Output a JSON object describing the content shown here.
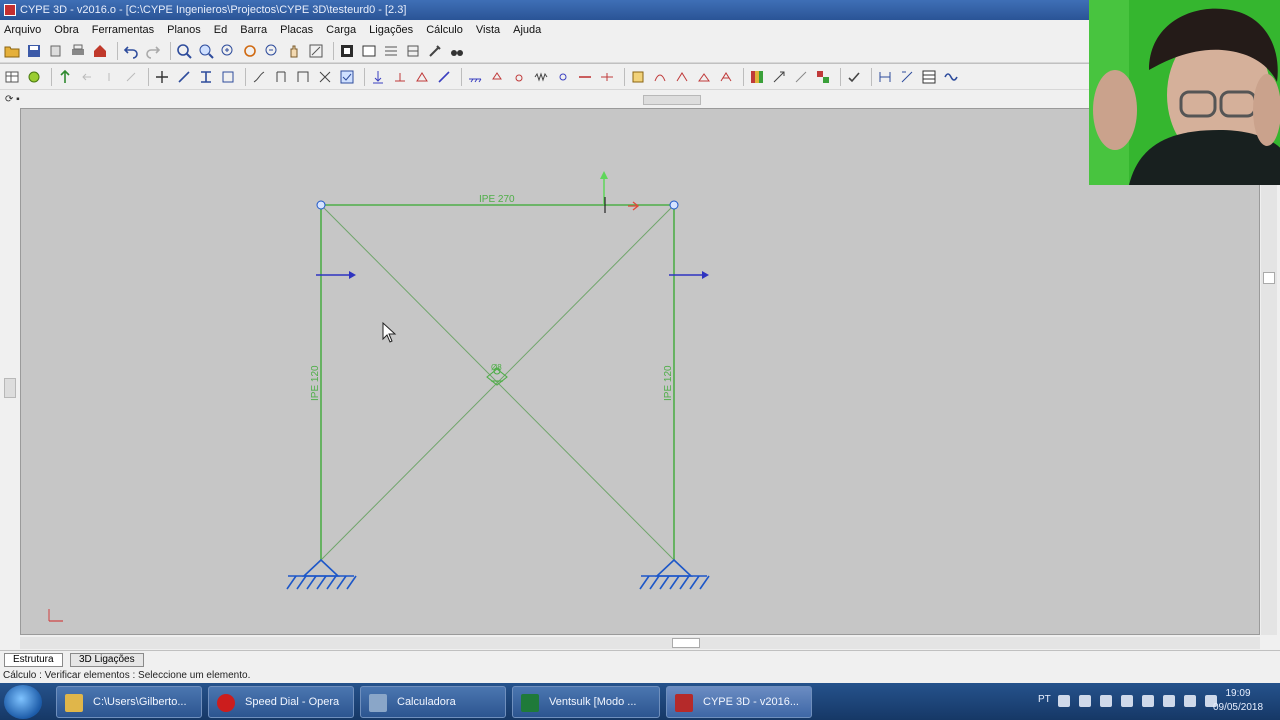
{
  "window": {
    "title": "CYPE 3D - v2016.o - [C:\\CYPE Ingenieros\\Projectos\\CYPE 3D\\testeurd0 - [2.3]"
  },
  "menu": [
    "Arquivo",
    "Obra",
    "Ferramentas",
    "Planos",
    "Ed",
    "Barra",
    "Placas",
    "Carga",
    "Ligações",
    "Cálculo",
    "Vista",
    "Ajuda"
  ],
  "model": {
    "beam_label": "IPE 270",
    "left_column_label": "IPE 120",
    "right_column_label": "IPE 120",
    "brace_label": "Ø8"
  },
  "tabs": {
    "structure": "Estrutura",
    "elevation": "3D Ligações"
  },
  "status": {
    "text": "Cálculo : Verificar elementos : Seleccione um elemento."
  },
  "taskbar": {
    "items": [
      {
        "label": "C:\\Users\\Gilberto...",
        "color": "#e0b64a"
      },
      {
        "label": "Speed Dial - Opera",
        "color": "#cc1d1d"
      },
      {
        "label": "Calculadora",
        "color": "#8aa6c8"
      },
      {
        "label": "Ventsulk [Modo ...",
        "color": "#1f7a3a"
      },
      {
        "label": "CYPE 3D - v2016...",
        "color": "#b52a2a"
      }
    ],
    "language": "PT",
    "time": "19:09",
    "date": "09/05/2018"
  },
  "colors": {
    "member": "#4fae48",
    "support": "#1d57c8",
    "load": "#2f34c0",
    "canvas": "#c6c6c6"
  }
}
